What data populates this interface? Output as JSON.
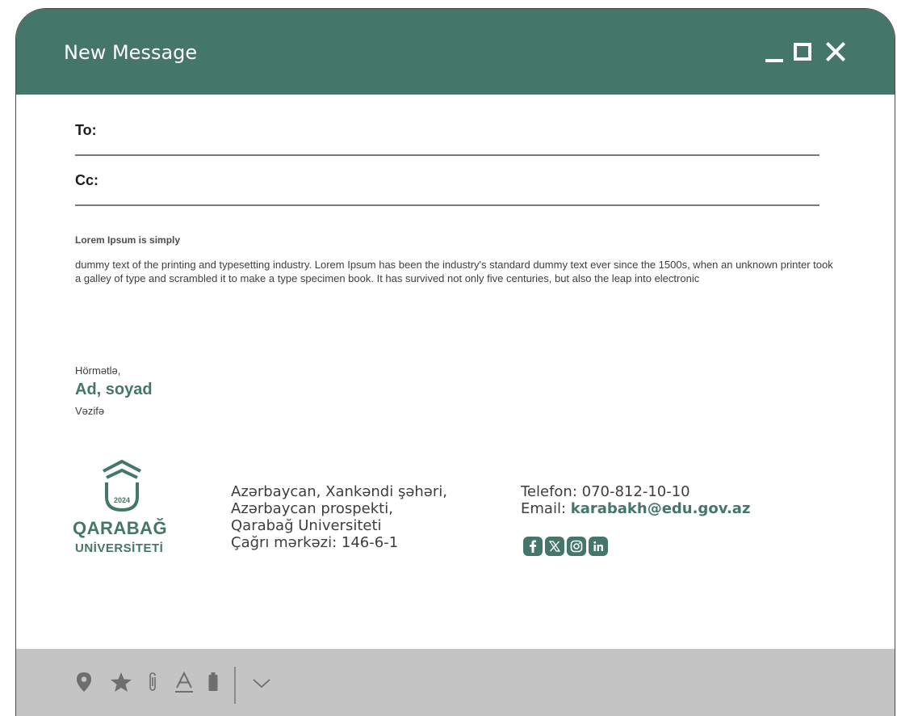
{
  "window": {
    "title": "New Message",
    "accent_color": "#44766a"
  },
  "fields": {
    "to_label": "To:",
    "to_value": "",
    "cc_label": "Cc:",
    "cc_value": ""
  },
  "message": {
    "subject": "Lorem Ipsum is simply",
    "body": "dummy text of the printing and typesetting industry. Lorem Ipsum has been the industry's standard dummy text ever since the 1500s, when an unknown printer took a galley of type and scrambled it to make a type specimen book. It has survived not only five centuries, but also the leap into electronic"
  },
  "signature": {
    "greeting": "Hörmətlə,",
    "name": "Ad, soyad",
    "position": "Vəzifə",
    "logo": {
      "year": "2024",
      "line1": "QARABAĞ",
      "line2": "UNİVERSİTETİ"
    },
    "address": [
      "Azərbaycan, Xankəndi şəhəri,",
      "Azərbaycan prospekti,",
      "Qarabağ Universiteti",
      "Çağrı mərkəzi: 146-6-1"
    ],
    "phone": "Telefon: 070-812-10-10",
    "email_label": "Email: ",
    "email": "karabakh@edu.gov.az",
    "social": [
      "facebook-icon",
      "x-icon",
      "instagram-icon",
      "linkedin-icon"
    ]
  },
  "toolbar": {
    "icons": [
      "location-pin-icon",
      "star-icon",
      "paperclip-icon",
      "text-format-icon",
      "battery-icon",
      "chevron-down-icon"
    ]
  }
}
